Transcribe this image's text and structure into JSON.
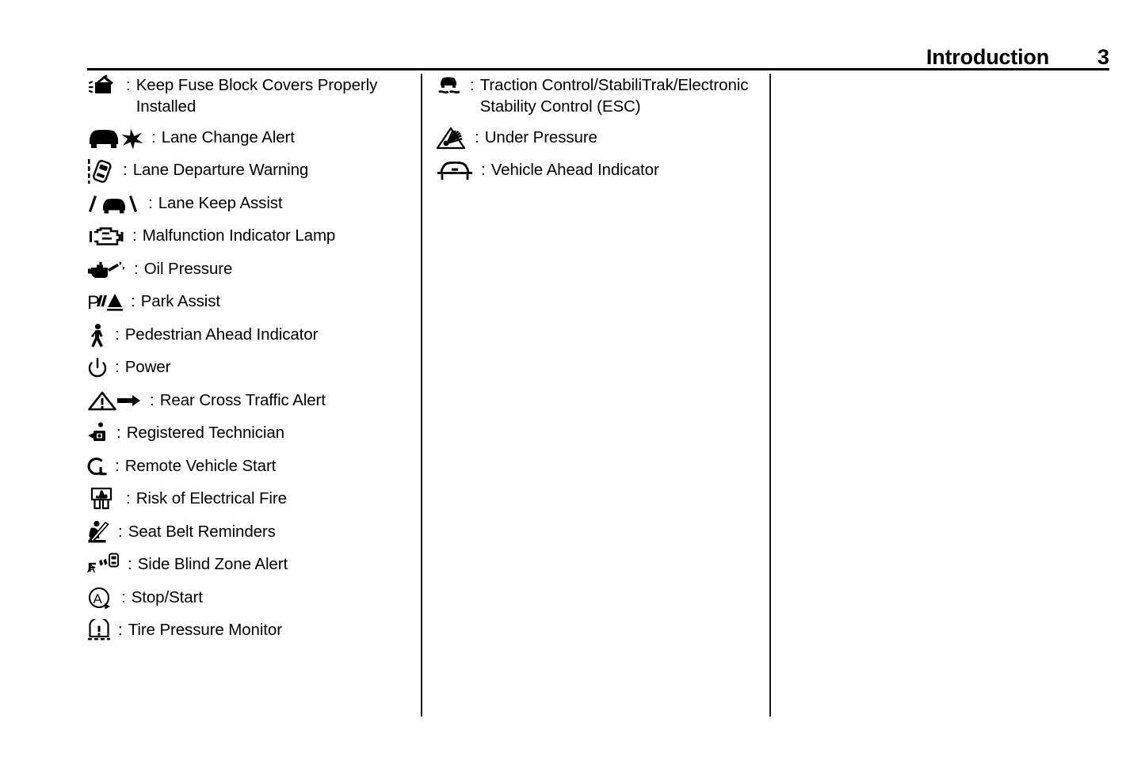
{
  "header": {
    "title": "Introduction",
    "page_number": "3"
  },
  "columns": [
    {
      "name": "column-1",
      "items": [
        {
          "icon": "fuse-block-cover-icon",
          "separator": ":",
          "label": "Keep Fuse Block Covers Properly\nInstalled"
        },
        {
          "icon": "lane-change-alert-icon",
          "separator": ":",
          "label": "Lane Change Alert"
        },
        {
          "icon": "lane-departure-warning-icon",
          "separator": ":",
          "label": "Lane Departure Warning"
        },
        {
          "icon": "lane-keep-assist-icon",
          "separator": ":",
          "label": "Lane Keep Assist"
        },
        {
          "icon": "malfunction-indicator-lamp-icon",
          "separator": ":",
          "label": "Malfunction Indicator Lamp"
        },
        {
          "icon": "oil-pressure-icon",
          "separator": ":",
          "label": "Oil Pressure"
        },
        {
          "icon": "park-assist-icon",
          "separator": ":",
          "label": "Park Assist"
        },
        {
          "icon": "pedestrian-ahead-indicator-icon",
          "separator": ":",
          "label": "Pedestrian Ahead Indicator"
        },
        {
          "icon": "power-icon",
          "separator": ":",
          "label": "Power"
        },
        {
          "icon": "rear-cross-traffic-alert-icon",
          "separator": ":",
          "label": "Rear Cross Traffic Alert"
        },
        {
          "icon": "registered-technician-icon",
          "separator": ":",
          "label": "Registered Technician"
        },
        {
          "icon": "remote-vehicle-start-icon",
          "separator": ":",
          "label": "Remote Vehicle Start"
        },
        {
          "icon": "risk-of-electrical-fire-icon",
          "separator": ":",
          "label": "Risk of Electrical Fire"
        },
        {
          "icon": "seat-belt-reminders-icon",
          "separator": ":",
          "label": "Seat Belt Reminders"
        },
        {
          "icon": "side-blind-zone-alert-icon",
          "separator": ":",
          "label": "Side Blind Zone Alert"
        },
        {
          "icon": "stop-start-icon",
          "separator": ":",
          "label": "Stop/Start"
        },
        {
          "icon": "tire-pressure-monitor-icon",
          "separator": ":",
          "label": "Tire Pressure Monitor"
        }
      ]
    },
    {
      "name": "column-2",
      "items": [
        {
          "icon": "traction-control-icon",
          "separator": ":",
          "label": "Traction Control/StabiliTrak/Electronic\nStability Control (ESC)"
        },
        {
          "icon": "under-pressure-icon",
          "separator": ":",
          "label": "Under Pressure"
        },
        {
          "icon": "vehicle-ahead-indicator-icon",
          "separator": ":",
          "label": "Vehicle Ahead Indicator"
        }
      ]
    },
    {
      "name": "column-3",
      "items": []
    }
  ],
  "colors": {
    "ink": "#000000",
    "rule": "#1a1a1a",
    "page_background": "#ffffff"
  }
}
